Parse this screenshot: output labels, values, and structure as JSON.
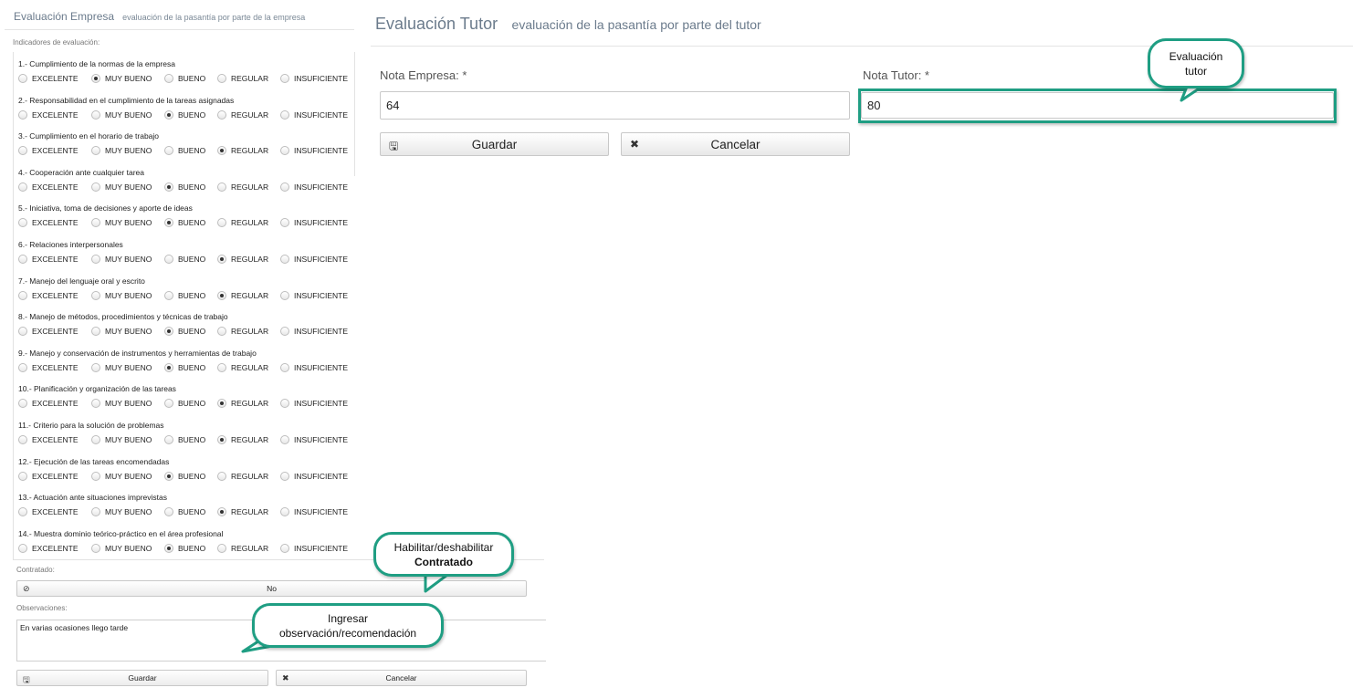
{
  "empresa_panel": {
    "title": "Evaluación Empresa",
    "subtitle": "evaluación de la pasantía por parte de la empresa",
    "indicators_label": "Indicadores de evaluación:",
    "options": [
      "EXCELENTE",
      "MUY BUENO",
      "BUENO",
      "REGULAR",
      "INSUFICIENTE"
    ],
    "indicators": [
      {
        "question": "1.- Cumplimiento de la normas de la empresa",
        "selected": "MUY BUENO"
      },
      {
        "question": "2.- Responsabilidad en el cumplimiento de la tareas asignadas",
        "selected": "BUENO"
      },
      {
        "question": "3.- Cumplimiento en el horario de trabajo",
        "selected": "REGULAR"
      },
      {
        "question": "4.- Cooperación ante cualquier tarea",
        "selected": "BUENO"
      },
      {
        "question": "5.- Iniciativa, toma de decisiones y aporte de ideas",
        "selected": "BUENO"
      },
      {
        "question": "6.- Relaciones interpersonales",
        "selected": "REGULAR"
      },
      {
        "question": "7.- Manejo del lenguaje oral y escrito",
        "selected": "REGULAR"
      },
      {
        "question": "8.- Manejo de métodos, procedimientos y técnicas de trabajo",
        "selected": "BUENO"
      },
      {
        "question": "9.- Manejo y conservación de instrumentos y herramientas de trabajo",
        "selected": "BUENO"
      },
      {
        "question": "10.- Planificación y organización de las tareas",
        "selected": "REGULAR"
      },
      {
        "question": "11.- Criterio para la solución de problemas",
        "selected": "REGULAR"
      },
      {
        "question": "12.- Ejecución de las tareas encomendadas",
        "selected": "BUENO"
      },
      {
        "question": "13.- Actuación ante situaciones imprevistas",
        "selected": "REGULAR"
      },
      {
        "question": "14.- Muestra dominio teórico-práctico en el área profesional",
        "selected": "BUENO"
      }
    ],
    "contratado_label": "Contratado:",
    "contratado_value": "No",
    "observaciones_label": "Observaciones:",
    "observaciones_value": "En varias ocasiones llego  tarde",
    "save_label": "Guardar",
    "cancel_label": "Cancelar"
  },
  "tutor_panel": {
    "title": "Evaluación Tutor",
    "subtitle": "evaluación de la pasantía por parte del tutor",
    "nota_empresa_label": "Nota Empresa:  *",
    "nota_empresa_value": "64",
    "nota_tutor_label": "Nota Tutor:  *",
    "nota_tutor_value": "80",
    "save_label": "Guardar",
    "cancel_label": "Cancelar"
  },
  "callouts": {
    "tutor_line1": "Evaluación",
    "tutor_line2": "tutor",
    "contratado_line1": "Habilitar/deshabilitar",
    "contratado_line2": "Contratado",
    "obs_line1": "Ingresar",
    "obs_line2": "observación/recomendación"
  },
  "colors": {
    "callout_border": "#1f9e83",
    "title_text": "#6b7b8c"
  },
  "icons": {
    "save": "floppy-disk-icon",
    "cancel": "x-icon",
    "toggle_off": "ban-icon"
  }
}
